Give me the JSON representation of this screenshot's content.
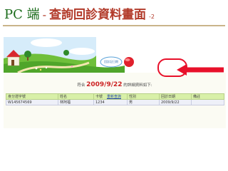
{
  "slide": {
    "title_prefix": "PC 端",
    "title_separator": "-",
    "title_main": "查詢回診資料畫面",
    "title_suffix": "-2"
  },
  "banner": {
    "badge_text": "回診記日期"
  },
  "result": {
    "prefix": "符合",
    "date": "2009/9/22",
    "suffix": "的詳細資料如下:"
  },
  "table": {
    "headers": [
      "身分證字號",
      "姓名",
      "卡號",
      "性別",
      "回診日期",
      "備註"
    ],
    "rows": [
      [
        "W145674569",
        "林阿福",
        "1234",
        "男",
        "2009/9/22",
        ""
      ]
    ]
  },
  "back_link": "重新查詢",
  "colors": {
    "title_green": "#1a6b1a",
    "title_red": "#b23a2a",
    "highlight_red": "#e8102a",
    "header_green": "#d8f0a8"
  },
  "icons": {
    "arrow": "left-arrow-icon"
  }
}
